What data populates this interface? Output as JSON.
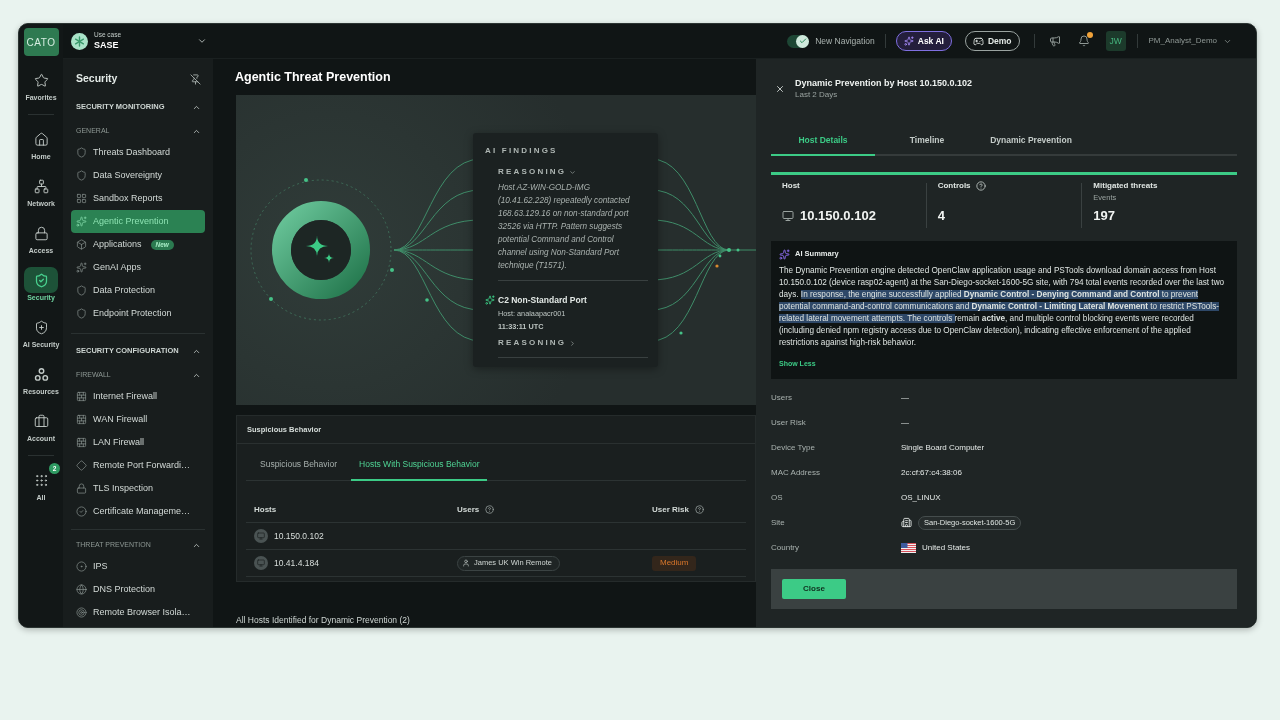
{
  "app": {
    "logo": "CATO",
    "use_case_label": "Use case",
    "use_case": "SASE"
  },
  "topbar": {
    "new_navigation": {
      "label": "New Navigation",
      "on": true
    },
    "ask_ai": "Ask AI",
    "demo": "Demo",
    "notifications_unread": true,
    "avatar": "JW",
    "user": "PM_Analyst_Demo"
  },
  "rail": {
    "items": [
      {
        "label": "Favorites",
        "selected": false
      },
      {
        "label": "Home",
        "selected": false
      },
      {
        "label": "Network",
        "selected": false
      },
      {
        "label": "Access",
        "selected": false
      },
      {
        "label": "Security",
        "selected": true
      },
      {
        "label": "AI Security",
        "selected": false
      },
      {
        "label": "Resources",
        "selected": false
      },
      {
        "label": "Account",
        "selected": false
      },
      {
        "label": "All",
        "selected": false,
        "badge": "2"
      }
    ]
  },
  "sidebar": {
    "title": "Security",
    "sections": [
      {
        "title": "SECURITY MONITORING",
        "expanded": true,
        "groups": [
          {
            "title": "GENERAL",
            "expanded": true,
            "items": [
              {
                "label": "Threats Dashboard",
                "selected": false
              },
              {
                "label": "Data Sovereignty",
                "selected": false
              },
              {
                "label": "Sandbox Reports",
                "selected": false
              },
              {
                "label": "Agentic Prevention",
                "selected": true
              },
              {
                "label": "Applications",
                "selected": false,
                "badge": "New"
              },
              {
                "label": "GenAI Apps",
                "selected": false
              },
              {
                "label": "Data Protection",
                "selected": false
              },
              {
                "label": "Endpoint Protection",
                "selected": false
              }
            ]
          }
        ]
      },
      {
        "title": "SECURITY CONFIGURATION",
        "expanded": true,
        "groups": [
          {
            "title": "FIREWALL",
            "expanded": true,
            "items": [
              {
                "label": "Internet Firewall",
                "selected": false
              },
              {
                "label": "WAN Firewall",
                "selected": false
              },
              {
                "label": "LAN Firewall",
                "selected": false
              },
              {
                "label": "Remote Port Forwardi…",
                "selected": false
              },
              {
                "label": "TLS Inspection",
                "selected": false
              },
              {
                "label": "Certificate Manageme…",
                "selected": false
              }
            ]
          },
          {
            "title": "THREAT PREVENTION",
            "expanded": true,
            "items": [
              {
                "label": "IPS",
                "selected": false
              },
              {
                "label": "DNS Protection",
                "selected": false
              },
              {
                "label": "Remote Browser Isola…",
                "selected": false
              }
            ]
          }
        ]
      }
    ]
  },
  "page": {
    "title": "Agentic Threat Prevention",
    "findings": {
      "title": "AI FINDINGS",
      "reasoning": {
        "label": "REASONING",
        "expanded": true,
        "text": "Host AZ-WIN-GOLD-IMG (10.41.62.228) repeatedly contacted 168.63.129.16 on non-standard port 32526 via HTTP. Pattern suggests potential Command and Control channel using Non-Standard Port technique (T1571)."
      },
      "finding": {
        "title": "C2 Non-Standard Port",
        "host": "Host: analaapacr001",
        "time": "11:33:11 UTC",
        "reasoning": {
          "label": "REASONING",
          "expanded": false
        }
      }
    },
    "suspicious": {
      "title": "Suspicious Behavior",
      "tabs": [
        {
          "label": "Suspicious Behavior",
          "selected": false
        },
        {
          "label": "Hosts With Suspicious Behavior",
          "selected": true
        }
      ],
      "columns": [
        {
          "label": "Hosts",
          "help": false
        },
        {
          "label": "Users",
          "help": true
        },
        {
          "label": "User Risk",
          "help": true
        }
      ],
      "rows": [
        {
          "host": "10.150.0.102"
        },
        {
          "host": "10.41.4.184",
          "user": "James UK Win Remote",
          "risk": {
            "label": "Medium",
            "kind": "medium"
          }
        }
      ]
    },
    "footer": "All Hosts Identified for Dynamic Prevention (2)"
  },
  "drawer": {
    "title": "Dynamic Prevention by Host 10.150.0.102",
    "subtitle": "Last 2 Days",
    "tabs": [
      {
        "label": "Host Details",
        "selected": true
      },
      {
        "label": "Timeline",
        "selected": false
      },
      {
        "label": "Dynamic Prevention",
        "selected": false
      }
    ],
    "stats": [
      {
        "kind": "host",
        "label": "Host",
        "value": "10.150.0.102"
      },
      {
        "kind": "help",
        "label": "Controls",
        "value": "4"
      },
      {
        "kind": "plain",
        "label": "Mitigated threats",
        "sublabel": "Events",
        "value": "197"
      }
    ],
    "summary": {
      "title": "AI Summary",
      "segments": [
        {
          "text": "The Dynamic Prevention engine detected OpenClaw application usage and PSTools download domain access from Host 10.150.0.102 (device rasp02-agent) at the San-Diego-socket-1600-5G site, with 794 total events recorded over the last two days. ",
          "selected": false
        },
        {
          "text": "In response, the engine successfully applied **Dynamic Control - Denying Command and Control** to prevent potential command-and-control communications and **Dynamic Control - Limiting Lateral Movement** to restrict PSTools-related lateral movement attempts. The controls ",
          "selected": true
        },
        {
          "text": "remain **active**, and multiple control blocking events were recorded (including denied npm registry access due to OpenClaw detection), indicating effective enforcement of the applied restrictions against high-risk behavior.",
          "selected": false
        }
      ],
      "toggle": "Show Less"
    },
    "details": [
      {
        "kind": "text",
        "label": "Users",
        "value": "—"
      },
      {
        "kind": "text",
        "label": "User Risk",
        "value": "—"
      },
      {
        "kind": "text",
        "label": "Device Type",
        "value": "Single Board Computer"
      },
      {
        "kind": "text",
        "label": "MAC Address",
        "value": "2c:cf:67:c4:38:06"
      },
      {
        "kind": "text",
        "label": "OS",
        "value": "OS_LINUX"
      },
      {
        "kind": "site",
        "label": "Site",
        "value": "San-Diego-socket-1600-5G"
      },
      {
        "kind": "country",
        "label": "Country",
        "value": "United States"
      }
    ],
    "close": "Close"
  }
}
